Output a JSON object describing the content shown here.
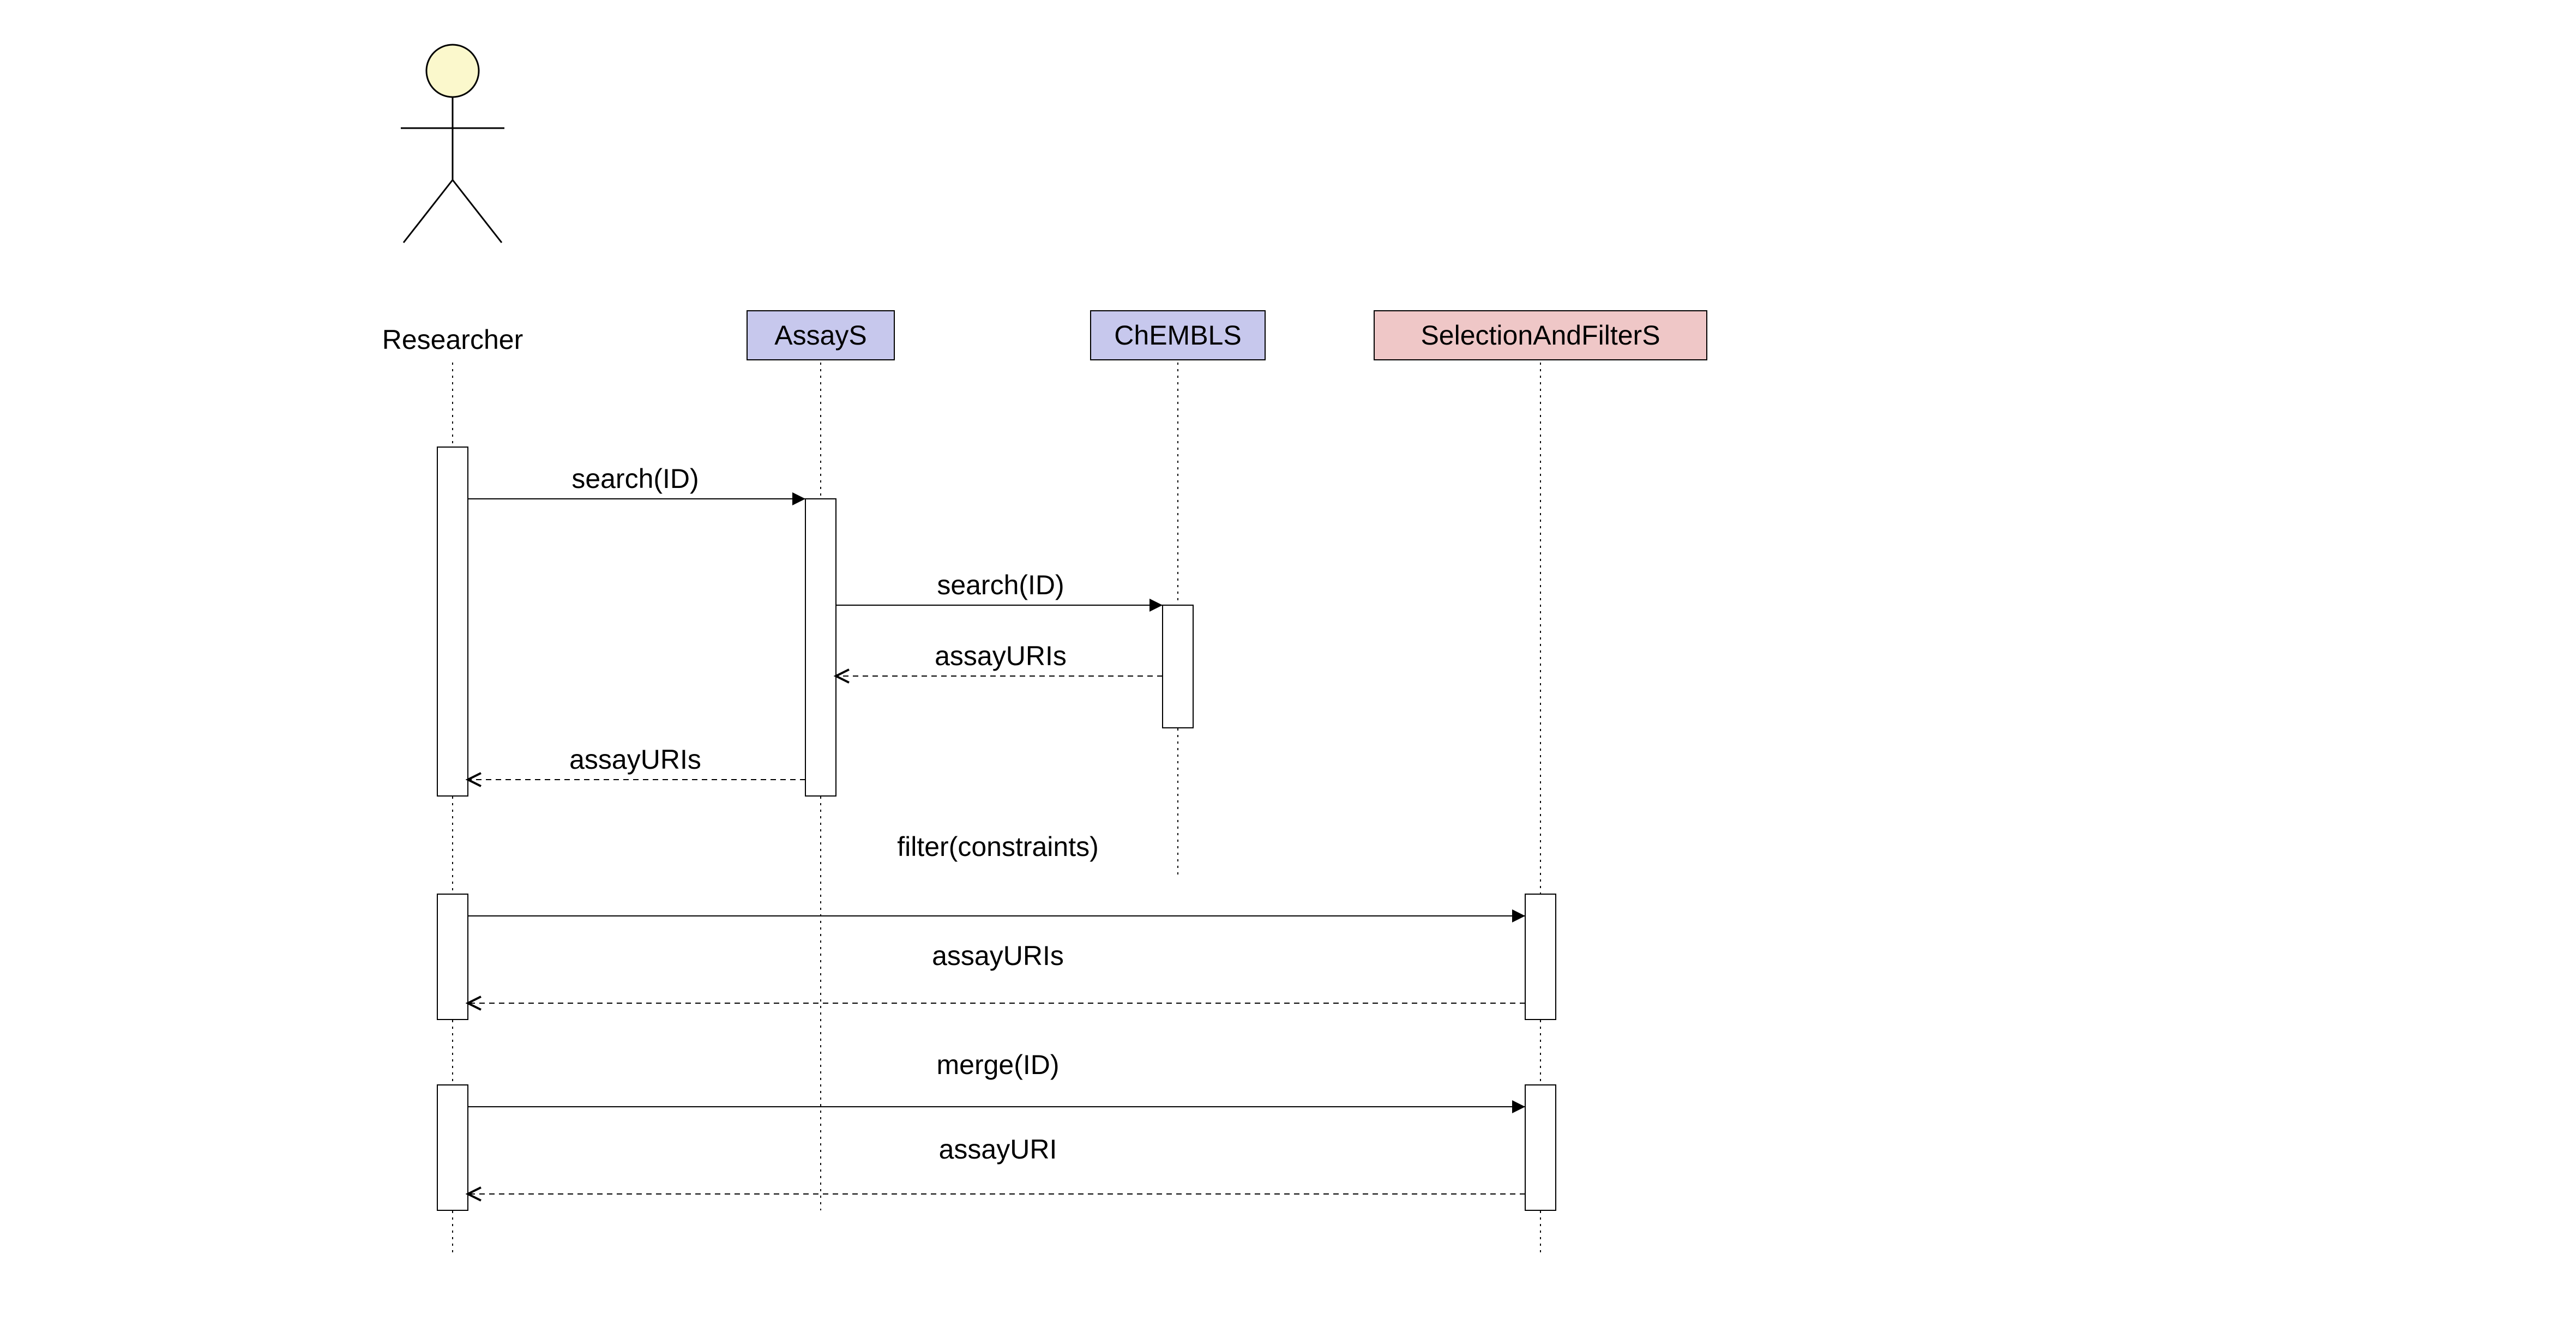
{
  "diagram": {
    "type": "sequence",
    "participants": {
      "researcher": {
        "label": "Researcher",
        "kind": "actor"
      },
      "assayS": {
        "label": "AssayS",
        "kind": "box",
        "fill": "#c7c8ed"
      },
      "chemblS": {
        "label": "ChEMBLS",
        "kind": "box",
        "fill": "#c7c8ed"
      },
      "selectionAndFilterS": {
        "label": "SelectionAndFilterS",
        "kind": "box",
        "fill": "#efc7c7"
      }
    },
    "messages": [
      {
        "from": "researcher",
        "to": "assayS",
        "label": "search(ID)",
        "style": "solid"
      },
      {
        "from": "assayS",
        "to": "chemblS",
        "label": "search(ID)",
        "style": "solid"
      },
      {
        "from": "chemblS",
        "to": "assayS",
        "label": "assayURIs",
        "style": "dashed"
      },
      {
        "from": "assayS",
        "to": "researcher",
        "label": "assayURIs",
        "style": "dashed"
      },
      {
        "from": "researcher",
        "to": "selectionAndFilterS",
        "label": "filter(constraints)",
        "style": "solid"
      },
      {
        "from": "selectionAndFilterS",
        "to": "researcher",
        "label": "assayURIs",
        "style": "dashed"
      },
      {
        "from": "researcher",
        "to": "selectionAndFilterS",
        "label": "merge(ID)",
        "style": "solid"
      },
      {
        "from": "selectionAndFilterS",
        "to": "researcher",
        "label": "assayURI",
        "style": "dashed"
      }
    ]
  }
}
